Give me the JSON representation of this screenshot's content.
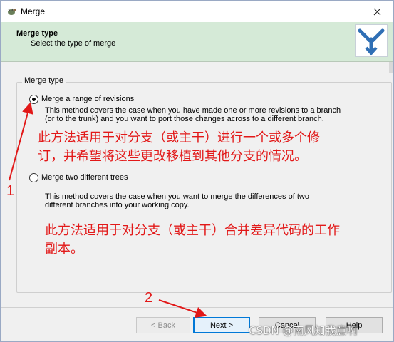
{
  "window": {
    "title": "Merge"
  },
  "header": {
    "title": "Merge type",
    "subtitle": "Select the type of merge"
  },
  "group": {
    "label": "Merge type"
  },
  "options": [
    {
      "label": "Merge a range of revisions",
      "checked": true,
      "desc_lines": [
        "This method covers the case when you have made one or more revisions to a branch",
        "(or to the trunk) and you want to port those changes across to a different branch."
      ]
    },
    {
      "label": "Merge two different trees",
      "checked": false,
      "desc_lines": [
        "This method covers the case when you want to merge the differences of two",
        "different branches into your working copy."
      ]
    }
  ],
  "annotations": {
    "note1_lines": [
      "此方法适用于对分支（或主干）进行一个或多个修",
      "订，并希望将这些更改移植到其他分支的情况。"
    ],
    "note2_lines": [
      "此方法适用于对分支（或主干）合并差异代码的工作",
      "副本。"
    ],
    "marker1": "1",
    "marker2": "2",
    "color": "#e21818"
  },
  "buttons": {
    "back": "< Back",
    "next": "Next >",
    "cancel": "Cancel",
    "help": "Help"
  },
  "watermark": "CSDN @南风知我意啊",
  "icons": {
    "app": "tortoise-icon",
    "close": "close-icon",
    "logo": "merge-logo-icon"
  }
}
